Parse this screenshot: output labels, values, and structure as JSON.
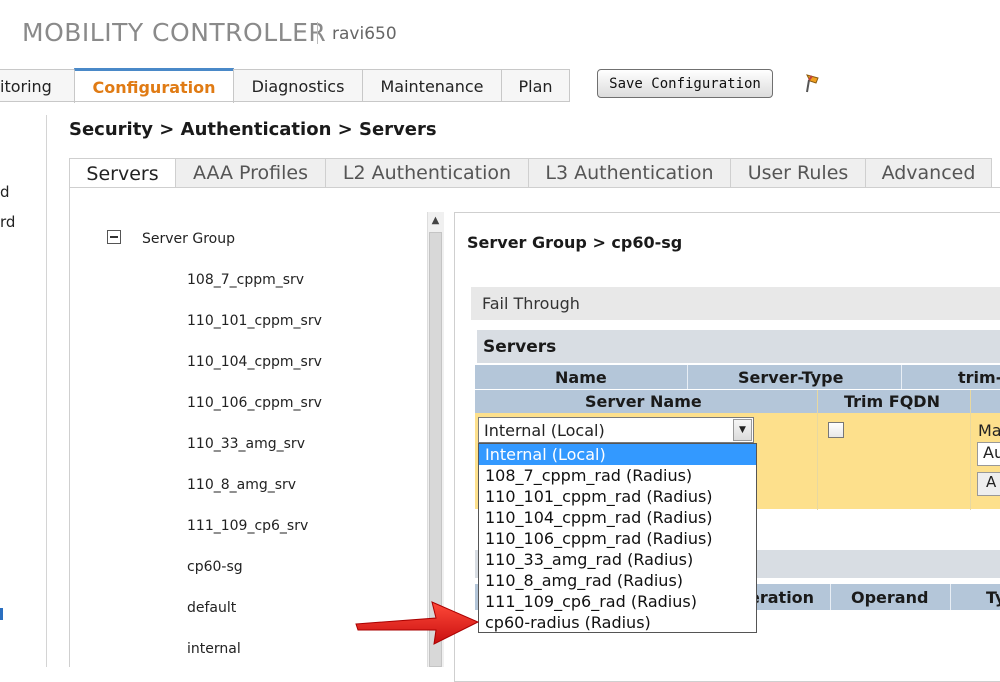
{
  "header": {
    "app_title": "MOBILITY CONTROLLER",
    "controller_name": "ravi650"
  },
  "topnav": {
    "tabs": [
      {
        "label": "itoring"
      },
      {
        "label": "Configuration",
        "active": true
      },
      {
        "label": "Diagnostics"
      },
      {
        "label": "Maintenance"
      },
      {
        "label": "Plan"
      }
    ],
    "save_label": "Save Configuration",
    "flag_icon": "pin-flag-icon"
  },
  "sidebar": {
    "fragments": [
      "d",
      "rd"
    ]
  },
  "breadcrumb": "Security > Authentication > Servers",
  "subtabs": [
    {
      "label": "Servers",
      "active": true
    },
    {
      "label": "AAA Profiles"
    },
    {
      "label": "L2 Authentication"
    },
    {
      "label": "L3 Authentication"
    },
    {
      "label": "User Rules"
    },
    {
      "label": "Advanced"
    }
  ],
  "tree": {
    "root_label": "Server Group",
    "items": [
      "108_7_cppm_srv",
      "110_101_cppm_srv",
      "110_104_cppm_srv",
      "110_106_cppm_srv",
      "110_33_amg_srv",
      "110_8_amg_srv",
      "111_109_cp6_srv",
      "cp60-sg",
      "default",
      "internal"
    ]
  },
  "panel": {
    "title": "Server Group > cp60-sg",
    "fail_through_label": "Fail Through",
    "servers_section_title": "Servers",
    "columns": [
      "Name",
      "Server-Type",
      "trim-"
    ],
    "edit_columns": [
      "Server Name",
      "Trim FQDN"
    ],
    "match_fragment": "Ma",
    "match_input_fragment": "Au",
    "match_button_fragment": "A",
    "lower_columns": [
      "eration",
      "Operand",
      "Ty"
    ]
  },
  "server_select": {
    "value": "Internal (Local)",
    "options": [
      {
        "label": "Internal (Local)",
        "selected": true
      },
      {
        "label": "108_7_cppm_rad (Radius)"
      },
      {
        "label": "110_101_cppm_rad (Radius)"
      },
      {
        "label": "110_104_cppm_rad (Radius)"
      },
      {
        "label": "110_106_cppm_rad (Radius)"
      },
      {
        "label": "110_33_amg_rad (Radius)"
      },
      {
        "label": "110_8_amg_rad (Radius)"
      },
      {
        "label": "111_109_cp6_rad (Radius)"
      },
      {
        "label": "cp60-radius (Radius)"
      }
    ]
  },
  "colors": {
    "accent_orange": "#e07b14",
    "tab_highlight": "#4a89c8",
    "table_header": "#b4c6d9",
    "edit_row": "#fde08c",
    "selection": "#3399ff",
    "annotation_arrow": "#e31b1b"
  }
}
